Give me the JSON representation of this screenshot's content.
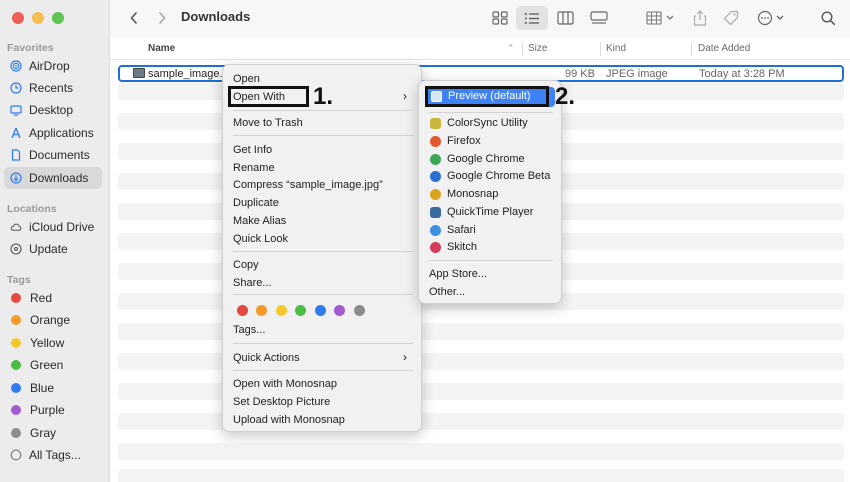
{
  "window": {
    "title": "Downloads"
  },
  "sidebar": {
    "favorites_label": "Favorites",
    "favorites": [
      {
        "label": "AirDrop",
        "icon": "airdrop-icon"
      },
      {
        "label": "Recents",
        "icon": "clock-icon"
      },
      {
        "label": "Desktop",
        "icon": "desktop-icon"
      },
      {
        "label": "Applications",
        "icon": "applications-icon"
      },
      {
        "label": "Documents",
        "icon": "document-icon"
      },
      {
        "label": "Downloads",
        "icon": "downloads-icon",
        "selected": true
      }
    ],
    "locations_label": "Locations",
    "locations": [
      {
        "label": "iCloud Drive",
        "icon": "cloud-icon"
      },
      {
        "label": "Update",
        "icon": "disk-icon"
      }
    ],
    "tags_label": "Tags",
    "tags": [
      {
        "label": "Red",
        "color": "#e5483f"
      },
      {
        "label": "Orange",
        "color": "#f39a2b"
      },
      {
        "label": "Yellow",
        "color": "#f5c92d"
      },
      {
        "label": "Green",
        "color": "#4bbd42"
      },
      {
        "label": "Blue",
        "color": "#2f7bf0"
      },
      {
        "label": "Purple",
        "color": "#a25bd1"
      },
      {
        "label": "Gray",
        "color": "#8c8c8c"
      },
      {
        "label": "All Tags...",
        "color": null
      }
    ]
  },
  "columns": {
    "name": "Name",
    "size": "Size",
    "kind": "Kind",
    "date_added": "Date Added"
  },
  "file": {
    "name": "sample_image.",
    "size": "99 KB",
    "kind": "JPEG image",
    "date_added": "Today at 3:28 PM"
  },
  "context_menu": {
    "open": "Open",
    "open_with": "Open With",
    "move_to_trash": "Move to Trash",
    "get_info": "Get Info",
    "rename": "Rename",
    "compress": "Compress “sample_image.jpg”",
    "duplicate": "Duplicate",
    "make_alias": "Make Alias",
    "quick_look": "Quick Look",
    "copy": "Copy",
    "share": "Share...",
    "tag_colors": [
      "#e5483f",
      "#f39a2b",
      "#f5c92d",
      "#4bbd42",
      "#2f7bf0",
      "#a25bd1",
      "#8c8c8c"
    ],
    "tags": "Tags...",
    "quick_actions": "Quick Actions",
    "open_monosnap": "Open with Monosnap",
    "set_desktop": "Set Desktop Picture",
    "upload_monosnap": "Upload with Monosnap"
  },
  "open_with_menu": {
    "default_app": "Preview (default)",
    "apps": [
      {
        "label": "ColorSync Utility",
        "color": "#c9b63a"
      },
      {
        "label": "Firefox",
        "color": "#e2572b"
      },
      {
        "label": "Google Chrome",
        "color": "#3aa757"
      },
      {
        "label": "Google Chrome Beta",
        "color": "#2c6fd1"
      },
      {
        "label": "Monosnap",
        "color": "#d9a521"
      },
      {
        "label": "QuickTime Player",
        "color": "#3b6c9e"
      },
      {
        "label": "Safari",
        "color": "#3d8fe0"
      },
      {
        "label": "Skitch",
        "color": "#d63b5a"
      }
    ],
    "app_store": "App Store...",
    "other": "Other..."
  },
  "annotations": {
    "step1": "1.",
    "step2": "2."
  },
  "accent_color": "#3e82f6"
}
